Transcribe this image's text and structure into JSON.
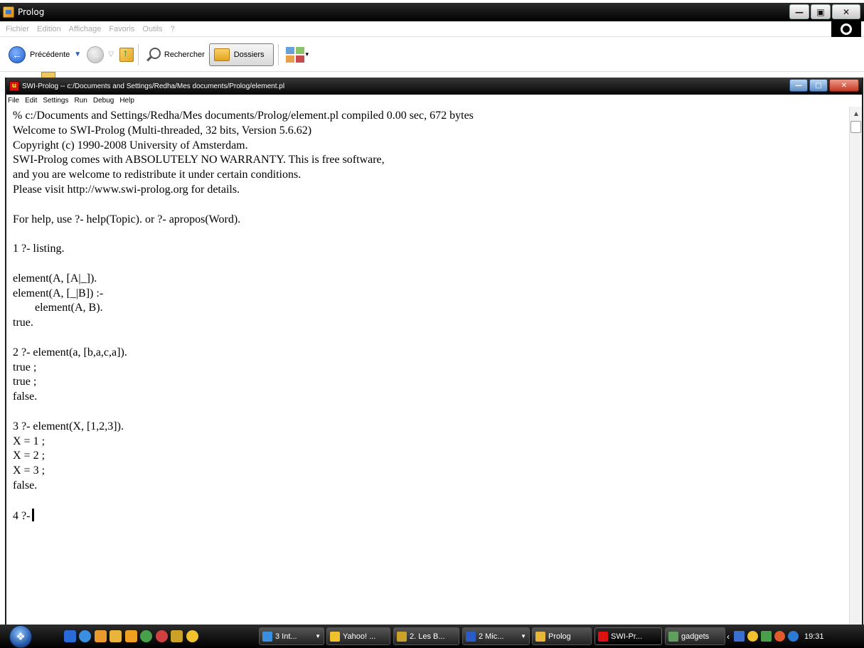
{
  "explorer": {
    "title": "Prolog",
    "menu": [
      "Fichier",
      "Edition",
      "Affichage",
      "Favoris",
      "Outils",
      "?"
    ],
    "toolbar": {
      "back_label": "Précédente",
      "search_label": "Rechercher",
      "folders_label": "Dossiers"
    }
  },
  "swi": {
    "title": "SWI-Prolog -- c:/Documents and Settings/Redha/Mes documents/Prolog/element.pl",
    "menu": [
      "File",
      "Edit",
      "Settings",
      "Run",
      "Debug",
      "Help"
    ],
    "console_lines": [
      "% c:/Documents and Settings/Redha/Mes documents/Prolog/element.pl compiled 0.00 sec, 672 bytes",
      "Welcome to SWI-Prolog (Multi-threaded, 32 bits, Version 5.6.62)",
      "Copyright (c) 1990-2008 University of Amsterdam.",
      "SWI-Prolog comes with ABSOLUTELY NO WARRANTY. This is free software,",
      "and you are welcome to redistribute it under certain conditions.",
      "Please visit http://www.swi-prolog.org for details.",
      "",
      "For help, use ?- help(Topic). or ?- apropos(Word).",
      "",
      "1 ?- listing.",
      "",
      "element(A, [A|_]).",
      "element(A, [_|B]) :-",
      "element(A, B).",
      "true.",
      "",
      "2 ?- element(a, [b,a,c,a]).",
      "true ;",
      "true ;",
      "false.",
      "",
      "3 ?- element(X, [1,2,3]).",
      "X = 1 ;",
      "X = 2 ;",
      "X = 3 ;",
      "false.",
      "",
      "4 ?-"
    ],
    "indented_line_index": 13
  },
  "taskbar": {
    "tasks": [
      {
        "label": "3 Int...",
        "icon": "ie-icon",
        "color": "#3b8fe0",
        "caret": true
      },
      {
        "label": "Yahoo! ...",
        "icon": "yahoo-messenger-icon",
        "color": "#f2c12e",
        "caret": false
      },
      {
        "label": "2. Les B...",
        "icon": "tool-icon",
        "color": "#c9a227",
        "caret": false
      },
      {
        "label": "2 Mic...",
        "icon": "word-icon",
        "color": "#2a5cc7",
        "caret": true
      },
      {
        "label": "Prolog",
        "icon": "folder-icon",
        "color": "#e8b43a",
        "caret": false
      },
      {
        "label": "SWI-Pr...",
        "icon": "swi-prolog-icon",
        "color": "#d11",
        "caret": false
      },
      {
        "label": "gadgets",
        "icon": "gadgets-icon",
        "color": "#5fa05f",
        "caret": false
      }
    ],
    "clock": "19:31"
  }
}
